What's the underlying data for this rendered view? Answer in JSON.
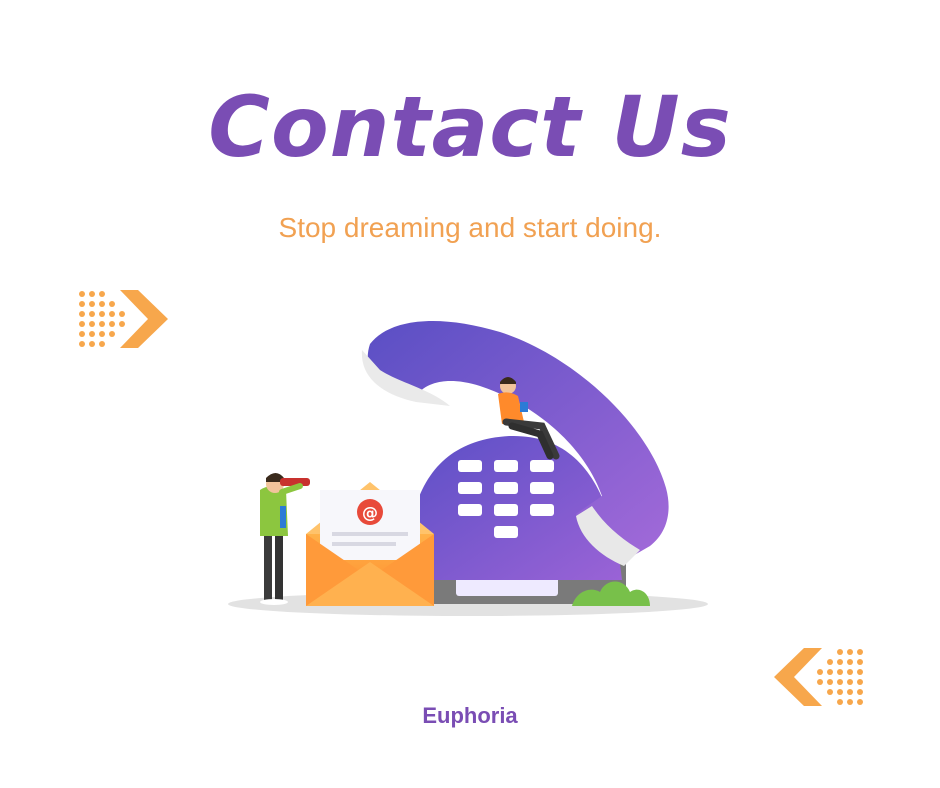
{
  "heading": {
    "title": "Contact Us"
  },
  "tagline": {
    "text": "Stop dreaming and start doing."
  },
  "footer": {
    "brand": "Euphoria"
  },
  "illustration": {
    "envelope_symbol": "@",
    "icons": [
      "telephone-illustration-icon",
      "envelope-icon",
      "person-with-binoculars-icon",
      "person-sitting-icon",
      "bush-icon",
      "arrow-right-icon",
      "arrow-left-icon"
    ]
  },
  "colors": {
    "title": "#7a4db4",
    "tagline": "#f1a152",
    "accent_orange": "#f7a74c",
    "phone_purple": "#7e57c6"
  }
}
